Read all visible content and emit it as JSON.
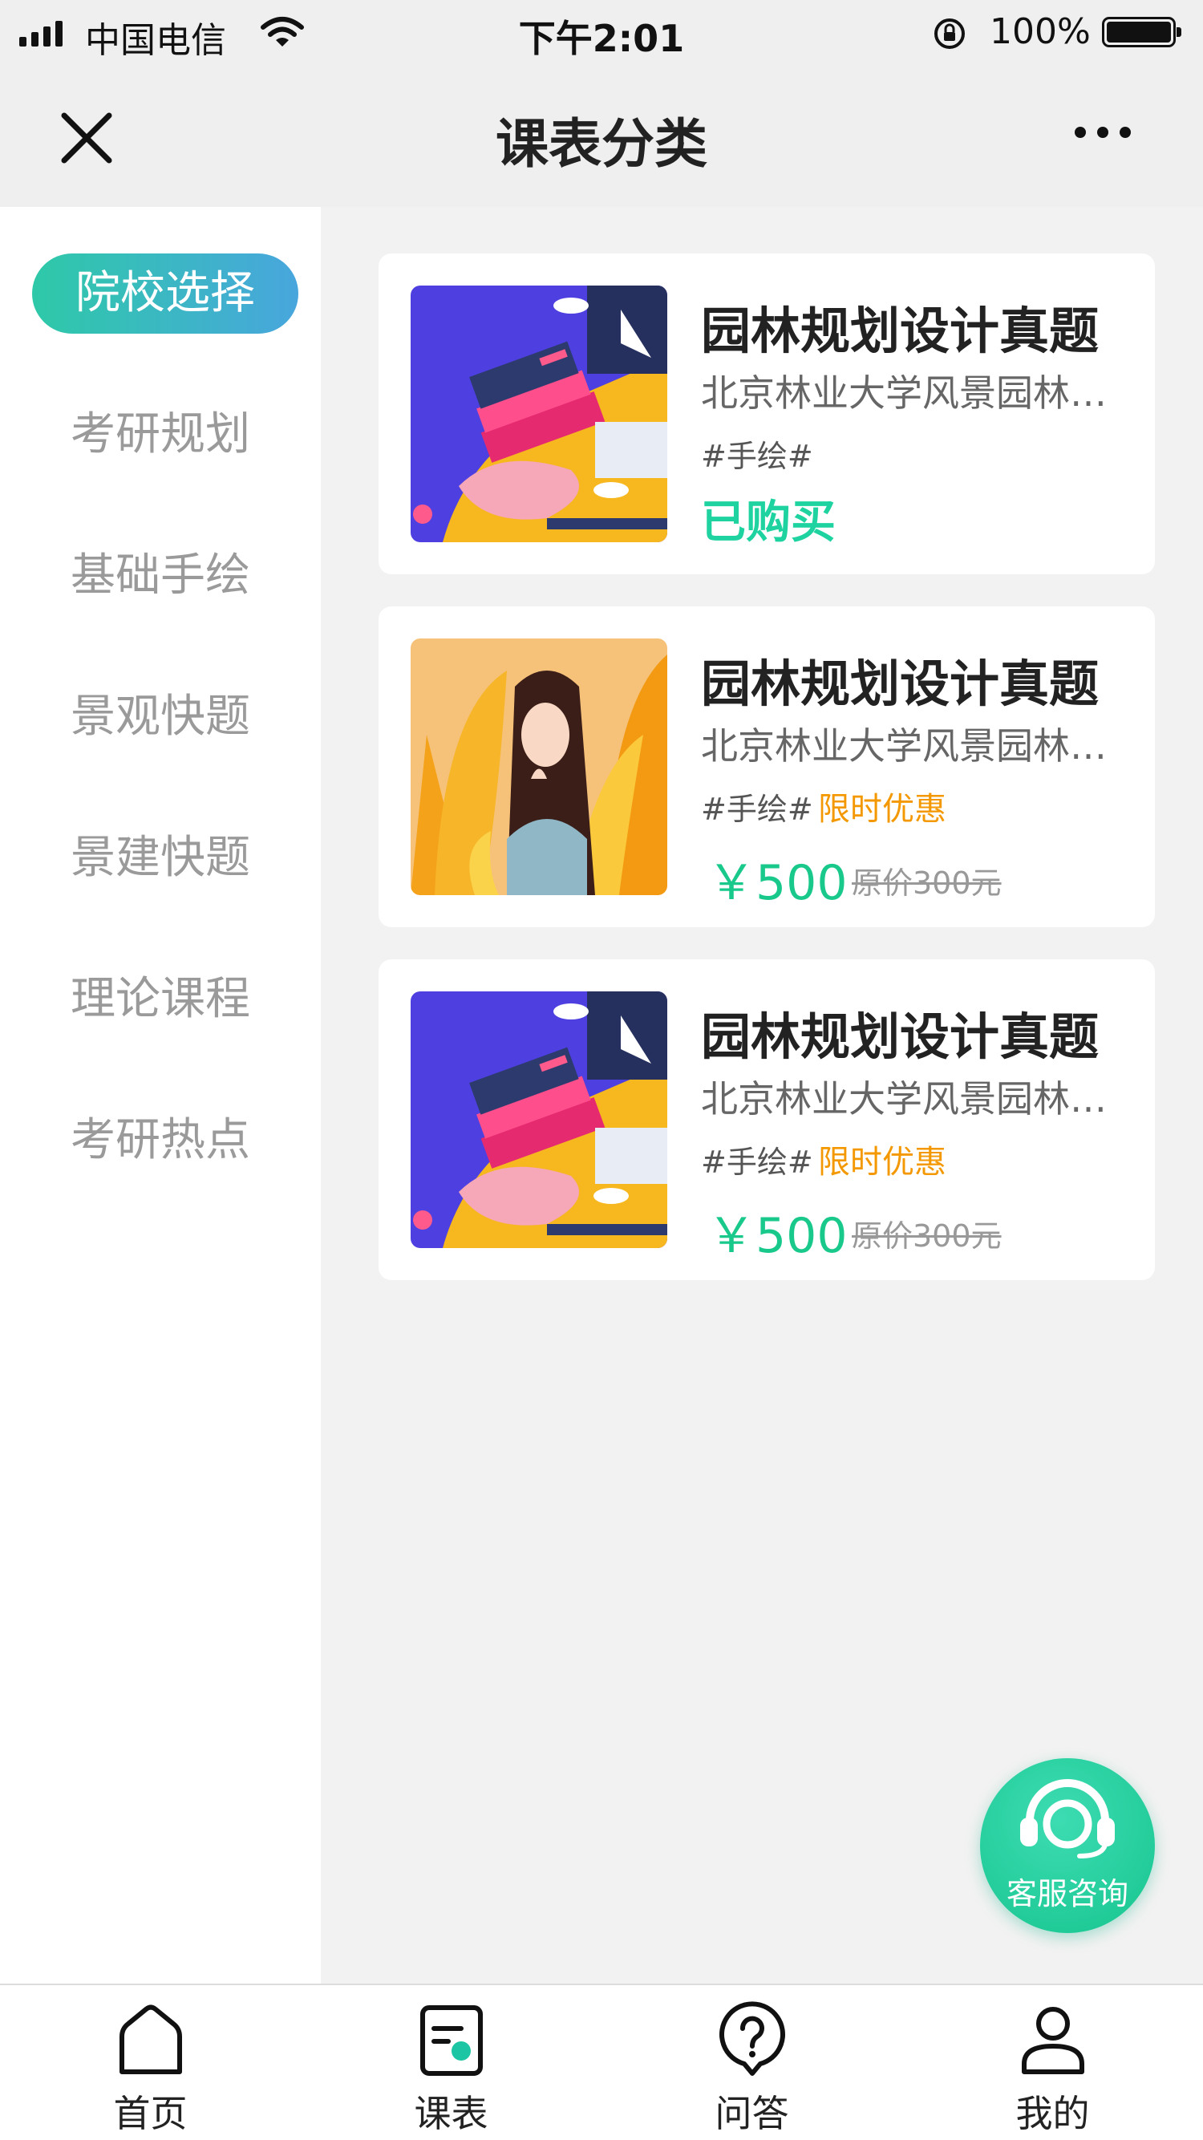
{
  "status_bar": {
    "carrier": "中国电信",
    "time": "下午2:01",
    "battery": "100%"
  },
  "nav": {
    "title": "课表分类"
  },
  "sidebar": {
    "items": [
      {
        "label": "院校选择"
      },
      {
        "label": "考研规划"
      },
      {
        "label": "基础手绘"
      },
      {
        "label": "景观快题"
      },
      {
        "label": "景建快题"
      },
      {
        "label": "理论课程"
      },
      {
        "label": "考研热点"
      }
    ]
  },
  "courses": [
    {
      "title": "园林规划设计真题",
      "subtitle": "北京林业大学风景园林专业考研真题",
      "tag": "#手绘#",
      "status": "已购买"
    },
    {
      "title": "园林规划设计真题",
      "subtitle": "北京林业大学风景园林专业考研真题",
      "tag": "#手绘#",
      "promo": "限时优惠",
      "price": "￥500",
      "original_price": "原价300元"
    },
    {
      "title": "园林规划设计真题",
      "subtitle": "北京林业大学风景园林专业考研真题",
      "tag": "#手绘#",
      "promo": "限时优惠",
      "price": "￥500",
      "original_price": "原价300元"
    }
  ],
  "service": {
    "label": "客服咨询"
  },
  "tabbar": {
    "items": [
      {
        "label": "首页",
        "icon": "home-icon"
      },
      {
        "label": "课表",
        "icon": "schedule-icon"
      },
      {
        "label": "问答",
        "icon": "question-icon"
      },
      {
        "label": "我的",
        "icon": "user-icon"
      }
    ]
  },
  "colors": {
    "accent_green": "#19c98b",
    "promo_orange": "#f39800",
    "active_gradient_start": "#2ec9a8",
    "active_gradient_end": "#48a6dd"
  }
}
